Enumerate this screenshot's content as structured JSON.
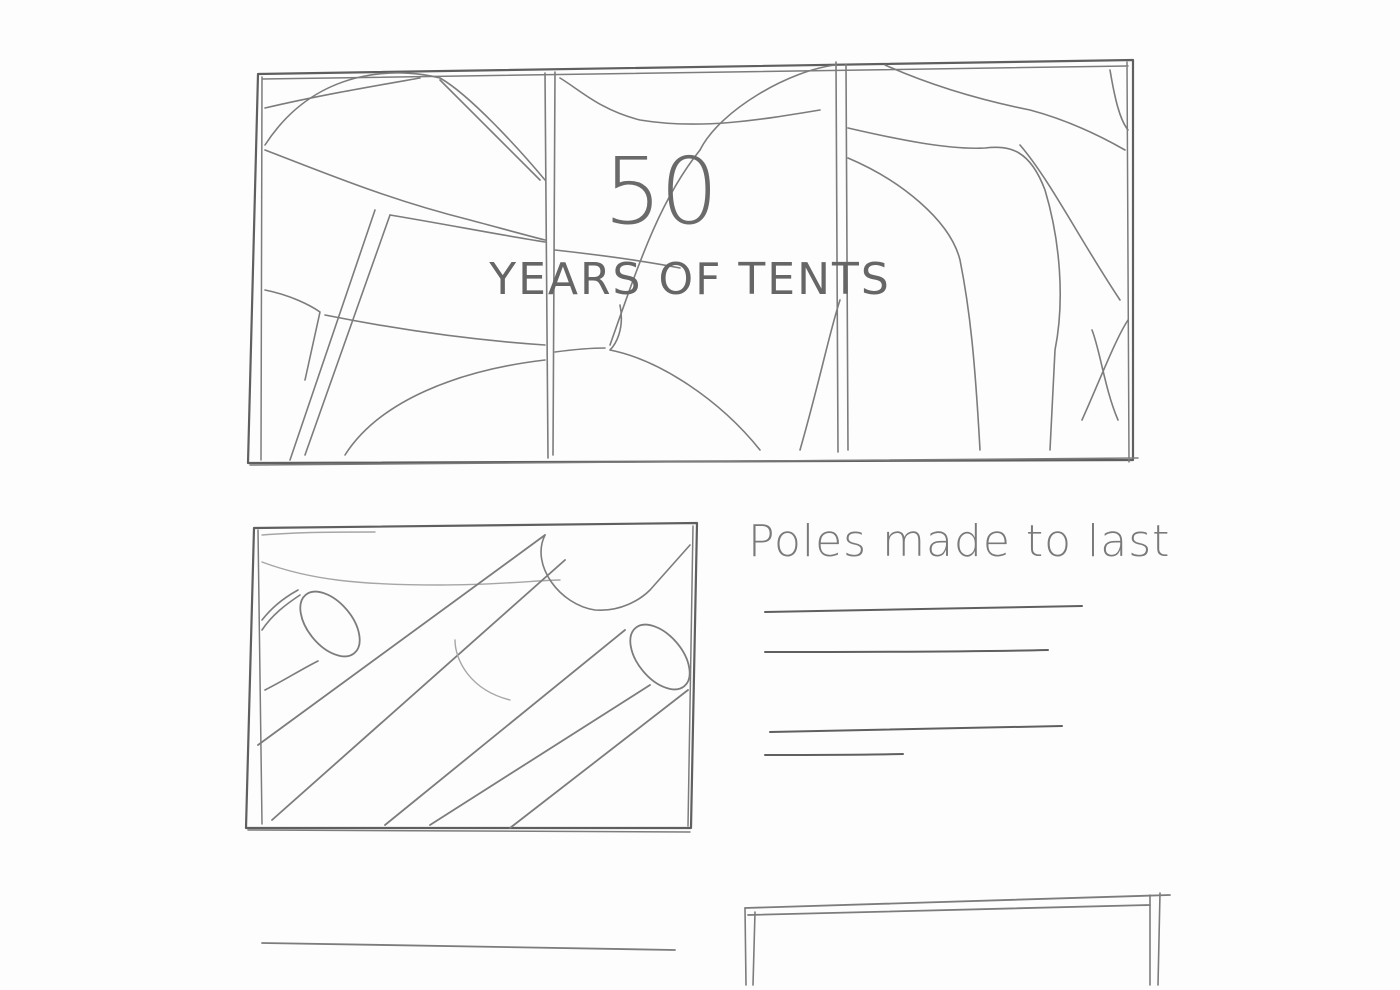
{
  "hero": {
    "number": "50",
    "subtitle": "YEARS OF TENTS",
    "image_icon": "tent-photo-icon"
  },
  "feature": {
    "heading": "Poles made to last",
    "image_icon": "tent-poles-icon",
    "body_lines": 4
  },
  "colors": {
    "pencil": "#7c7c7c",
    "paper": "#fdfdfd"
  }
}
